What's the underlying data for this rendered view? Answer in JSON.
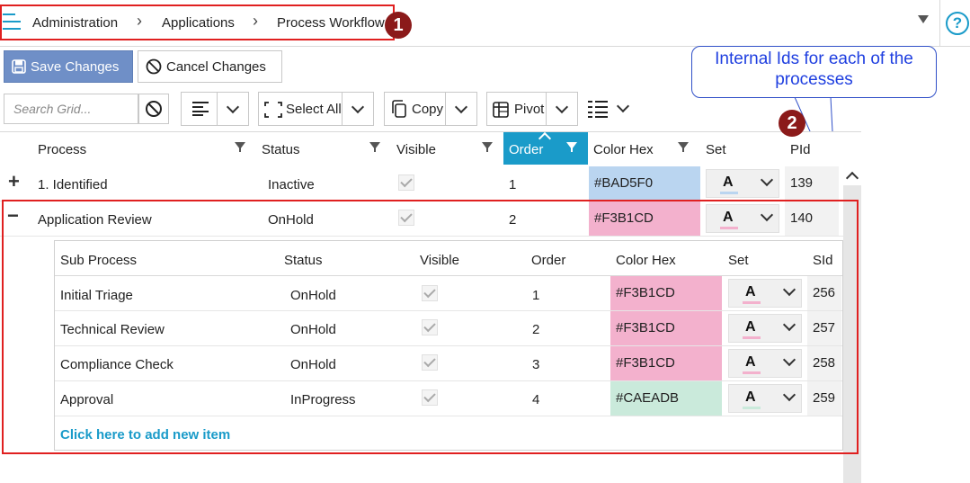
{
  "breadcrumb": {
    "items": [
      "Administration",
      "Applications",
      "Process Workflow"
    ]
  },
  "callouts": {
    "badge1": "1",
    "badge2": "2",
    "note": "Internal Ids for each of the processes"
  },
  "help": {
    "label": "?"
  },
  "actions": {
    "save": "Save Changes",
    "cancel": "Cancel Changes"
  },
  "toolbar": {
    "search_placeholder": "Search Grid...",
    "select_all": "Select All",
    "copy": "Copy",
    "pivot": "Pivot"
  },
  "grid": {
    "columns": [
      "Process",
      "Status",
      "Visible",
      "Order",
      "Color Hex",
      "Set",
      "PId"
    ],
    "sorted_column": "Order",
    "rows": [
      {
        "expander": "+",
        "process": "1. Identified",
        "status": "Inactive",
        "visible": true,
        "order": "1",
        "color_hex": "#BAD5F0",
        "set_color": "#BAD5F0",
        "pid": "139"
      },
      {
        "expander": "−",
        "process": "Application Review",
        "status": "OnHold",
        "visible": true,
        "order": "2",
        "color_hex": "#F3B1CD",
        "set_color": "#F3B1CD",
        "pid": "140"
      }
    ]
  },
  "subgrid": {
    "columns": [
      "Sub Process",
      "Status",
      "Visible",
      "Order",
      "Color Hex",
      "Set",
      "SId"
    ],
    "rows": [
      {
        "name": "Initial Triage",
        "status": "OnHold",
        "visible": true,
        "order": "1",
        "color_hex": "#F3B1CD",
        "set_color": "#F3B1CD",
        "sid": "256"
      },
      {
        "name": "Technical Review",
        "status": "OnHold",
        "visible": true,
        "order": "2",
        "color_hex": "#F3B1CD",
        "set_color": "#F3B1CD",
        "sid": "257"
      },
      {
        "name": "Compliance Check",
        "status": "OnHold",
        "visible": true,
        "order": "3",
        "color_hex": "#F3B1CD",
        "set_color": "#F3B1CD",
        "sid": "258"
      },
      {
        "name": "Approval",
        "status": "InProgress",
        "visible": true,
        "order": "4",
        "color_hex": "#CAEADB",
        "set_color": "#CAEADB",
        "sid": "259"
      }
    ],
    "add_item": "Click here to add new item"
  },
  "set_glyph": "A",
  "colors": {
    "accent": "#1A9BC9",
    "primary_button": "#6F8FC7",
    "callout_red": "#E02020",
    "badge": "#8B1A1A",
    "note_blue": "#1F3FE0"
  }
}
